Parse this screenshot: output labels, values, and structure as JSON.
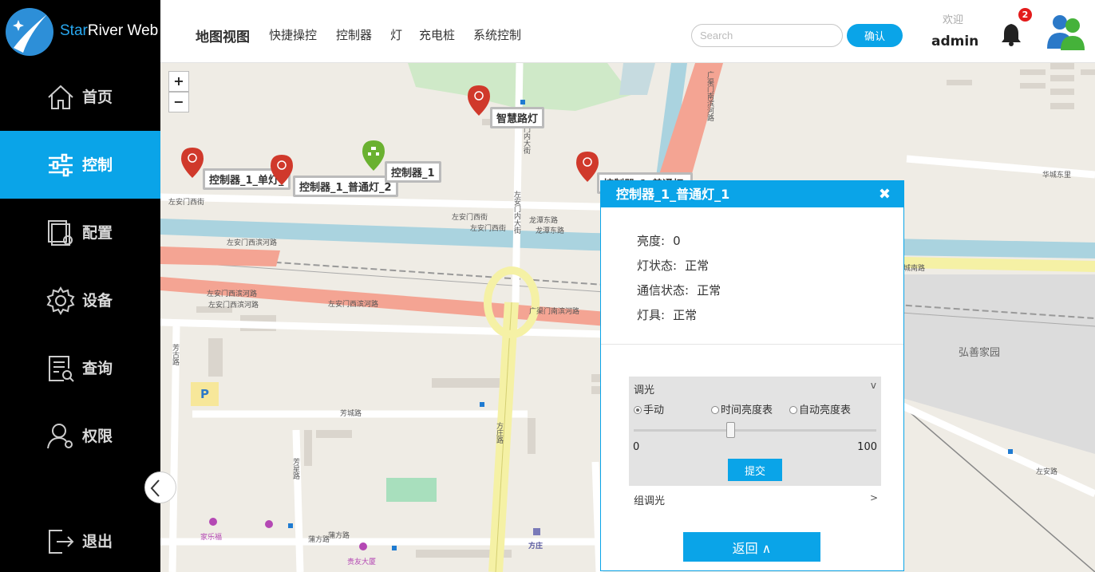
{
  "app": {
    "name_prefix": "Star",
    "name_rest": "River Web"
  },
  "sidebar": {
    "items": [
      {
        "label": "首页",
        "icon": "home-icon"
      },
      {
        "label": "控制",
        "icon": "sliders-icon",
        "active": true
      },
      {
        "label": "配置",
        "icon": "config-icon"
      },
      {
        "label": "设备",
        "icon": "gear-icon"
      },
      {
        "label": "查询",
        "icon": "query-icon"
      },
      {
        "label": "权限",
        "icon": "user-permission-icon"
      }
    ],
    "logout": "退出"
  },
  "topnav": {
    "items": [
      "地图视图",
      "快捷操控",
      "控制器",
      "灯",
      "充电桩",
      "系统控制"
    ],
    "search_placeholder": "Search",
    "confirm": "确认",
    "welcome": "欢迎",
    "user": "admin",
    "notifications": "2"
  },
  "map": {
    "zoom_in": "+",
    "zoom_out": "−",
    "markers": [
      {
        "label": "智慧路灯",
        "color": "#d0392b"
      },
      {
        "label": "控制器_1_单灯_",
        "color": "#d0392b"
      },
      {
        "label": "控制器_1_普通灯_2",
        "color": "#d0392b"
      },
      {
        "label": "控制器_1",
        "color": "#6ab130"
      },
      {
        "label": "控制器_1_普通灯_",
        "color": "#d0392b"
      }
    ],
    "labels": {
      "a": "左安门西街",
      "b": "左安门西街",
      "c": "左安门西滨河路",
      "d": "左安门西滨河路",
      "e": "左安门西滨河路",
      "f": "左安门西滨河路",
      "g": "广渠门南滨河路",
      "h": "龙潭东路",
      "i": "龙潭东路",
      "j": "左安门内大街",
      "k": "左安门内大街",
      "l": "左安门西街",
      "m": "芳古路",
      "n": "芳城路",
      "o": "方庄路",
      "p": "芳星路",
      "q": "蒲方路",
      "r": "蒲方路",
      "s": "家乐福",
      "t": "贵友大厦",
      "u": "方庄",
      "v": "弘善家园",
      "w": "左安路",
      "x": "城南路",
      "y": "广渠门南滨河路",
      "z": "华城东里",
      "p_sign": "P"
    }
  },
  "popup": {
    "title": "控制器_1_普通灯_1",
    "close": "✖",
    "info": [
      {
        "key": "亮度:",
        "value": "0"
      },
      {
        "key": "灯状态:",
        "value": "正常"
      },
      {
        "key": "通信状态:",
        "value": "正常"
      },
      {
        "key": "灯具:",
        "value": "正常"
      }
    ],
    "dimming": {
      "title": "调光",
      "chevron": "v",
      "modes": [
        "手动",
        "时间亮度表",
        "自动亮度表"
      ],
      "selected_mode": "手动",
      "slider_min": "0",
      "slider_max": "100",
      "slider_value": 40,
      "submit": "提交"
    },
    "group_dimming": "组调光",
    "group_chevron": ">",
    "back": "返回 ∧"
  },
  "colors": {
    "accent": "#0aa4e8",
    "sidebar_bg": "#000000",
    "marker_red": "#d0392b",
    "marker_green": "#6ab130"
  }
}
